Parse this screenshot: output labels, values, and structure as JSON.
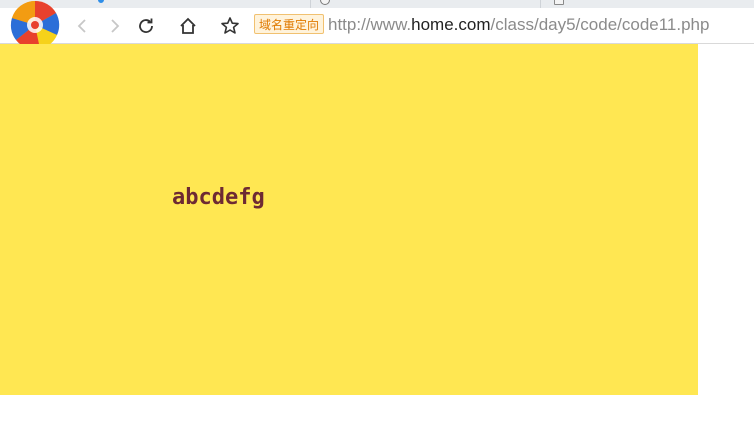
{
  "browser": {
    "tabs": [
      {
        "icon": "blue-dot-icon"
      },
      {
        "icon": "globe-icon"
      },
      {
        "icon": "page-icon"
      }
    ],
    "toolbar": {
      "back_icon": "chevron-left-icon",
      "forward_icon": "chevron-right-icon",
      "reload_icon": "reload-icon",
      "home_icon": "home-icon",
      "bookmark_icon": "star-icon",
      "redirect_badge": "域名重定向",
      "url": {
        "scheme": "http://www.",
        "host": "home.com",
        "path": "/class/day5/code/code11.php"
      }
    }
  },
  "page": {
    "box_color": "#ffe752",
    "text": "abcdefg",
    "text_color": "#6e2a33"
  }
}
